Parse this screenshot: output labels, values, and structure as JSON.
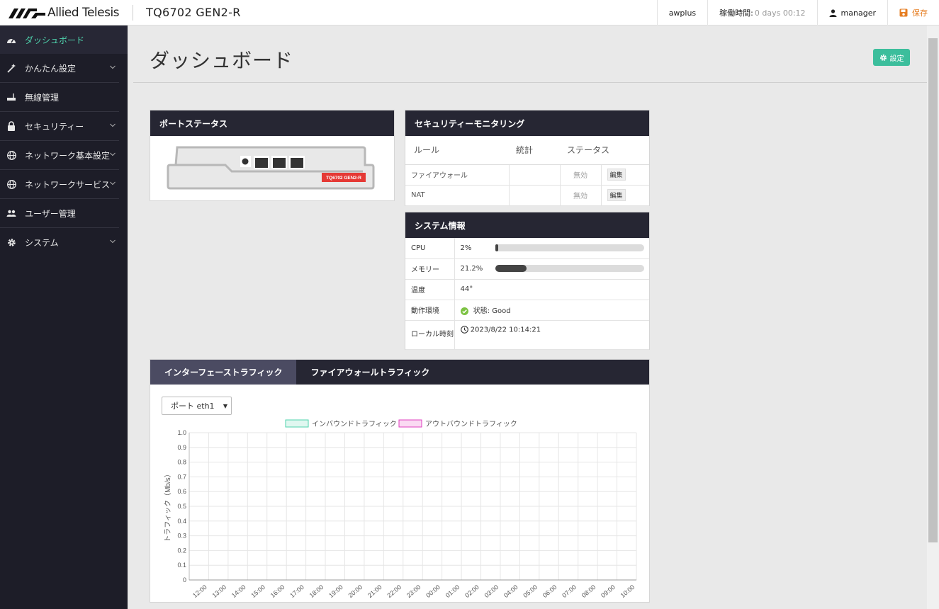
{
  "header": {
    "brand": "Allied Telesis",
    "product": "TQ6702 GEN2-R",
    "hostname": "awplus",
    "uptime_label": "稼働時間:",
    "uptime_value": "0 days 00:12",
    "user": "manager",
    "save_label": "保存"
  },
  "sidebar": {
    "items": [
      {
        "label": "ダッシュボード",
        "icon": "dashboard-icon",
        "active": true
      },
      {
        "label": "かんたん設定",
        "icon": "magic-wand-icon",
        "expandable": true
      },
      {
        "label": "無線管理",
        "icon": "wireless-icon"
      },
      {
        "label": "セキュリティー",
        "icon": "lock-icon",
        "expandable": true
      },
      {
        "label": "ネットワーク基本設定",
        "icon": "globe-icon",
        "expandable": true
      },
      {
        "label": "ネットワークサービス",
        "icon": "globe-icon",
        "expandable": true
      },
      {
        "label": "ユーザー管理",
        "icon": "users-icon"
      },
      {
        "label": "システム",
        "icon": "gear-icon",
        "expandable": true
      }
    ]
  },
  "main": {
    "title": "ダッシュボード",
    "settings_label": "設定"
  },
  "port_status": {
    "title": "ポートステータス",
    "device_label": "TQ6702 GEN2-R"
  },
  "security": {
    "title": "セキュリティーモニタリング",
    "columns": [
      "ルール",
      "統計",
      "ステータス"
    ],
    "rows": [
      {
        "rule": "ファイアウォール",
        "stat": "",
        "status": "無効",
        "action": "編集"
      },
      {
        "rule": "NAT",
        "stat": "",
        "status": "無効",
        "action": "編集"
      }
    ]
  },
  "system": {
    "title": "システム情報",
    "cpu_label": "CPU",
    "cpu_value": "2%",
    "cpu_fraction": 0.02,
    "mem_label": "メモリー",
    "mem_value": "21.2%",
    "mem_fraction": 0.212,
    "temp_label": "温度",
    "temp_value": "44°",
    "env_label": "動作環境",
    "env_value": "状態: Good",
    "time_label": "ローカル時刻",
    "time_value": "2023/8/22 10:14:21"
  },
  "traffic": {
    "tabs": [
      "インターフェーストラフィック",
      "ファイアウォールトラフィック"
    ],
    "port_select": "ポート eth1",
    "colors": {
      "inbound": "#4fd3ad",
      "outbound": "#e040c0",
      "accent": "#3cbe9c"
    }
  },
  "chart_data": {
    "type": "line",
    "title": "",
    "ylabel": "トラフィック（Mb/s）",
    "xlabel": "",
    "ylim": [
      0,
      1.0
    ],
    "yticks": [
      "0",
      "0.1",
      "0.2",
      "0.3",
      "0.4",
      "0.5",
      "0.6",
      "0.7",
      "0.8",
      "0.9",
      "1.0"
    ],
    "x": [
      "12:00",
      "13:00",
      "14:00",
      "15:00",
      "16:00",
      "17:00",
      "18:00",
      "19:00",
      "20:00",
      "21:00",
      "22:00",
      "23:00",
      "00:00",
      "01:00",
      "02:00",
      "03:00",
      "04:00",
      "05:00",
      "06:00",
      "07:00",
      "08:00",
      "09:00",
      "10:00"
    ],
    "legend_position": "top",
    "grid": true,
    "series": [
      {
        "name": "インバウンドトラフィック",
        "values": []
      },
      {
        "name": "アウトバウンドトラフィック",
        "values": []
      }
    ]
  }
}
